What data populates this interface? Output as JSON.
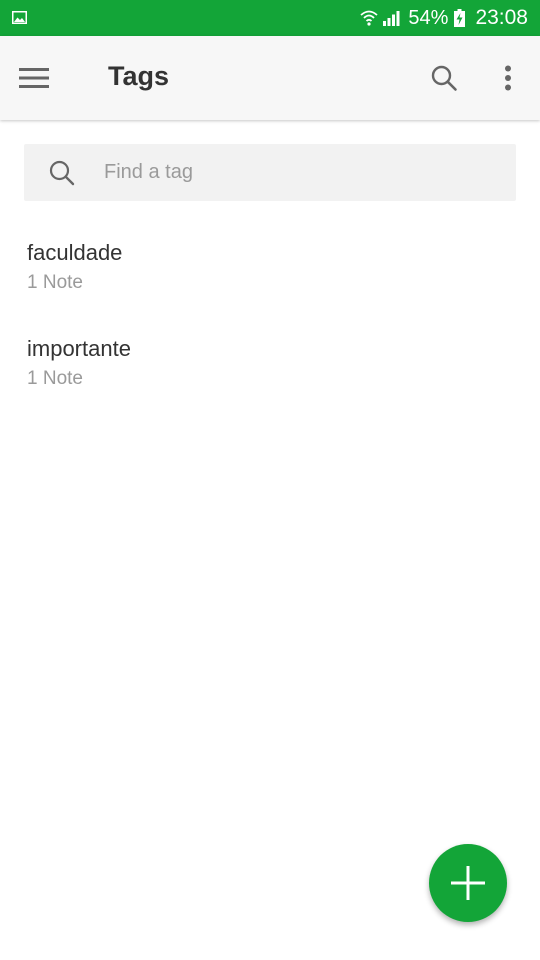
{
  "status_bar": {
    "battery": "54%",
    "time": "23:08",
    "icons": [
      "gallery-icon",
      "wifi-icon",
      "signal-icon",
      "battery-charging-icon"
    ]
  },
  "app_bar": {
    "title": "Tags",
    "icons": [
      "menu-icon",
      "search-icon",
      "more-vert-icon"
    ]
  },
  "search": {
    "placeholder": "Find a tag",
    "value": ""
  },
  "tags": [
    {
      "name": "faculdade",
      "count": "1 Note"
    },
    {
      "name": "importante",
      "count": "1 Note"
    }
  ],
  "fab": {
    "icon": "plus-icon"
  },
  "colors": {
    "accent": "#13a538",
    "app_bar_bg": "#f7f7f7",
    "search_bg": "#f2f2f2",
    "primary_text": "#333333",
    "secondary_text": "#9a9a9a"
  }
}
